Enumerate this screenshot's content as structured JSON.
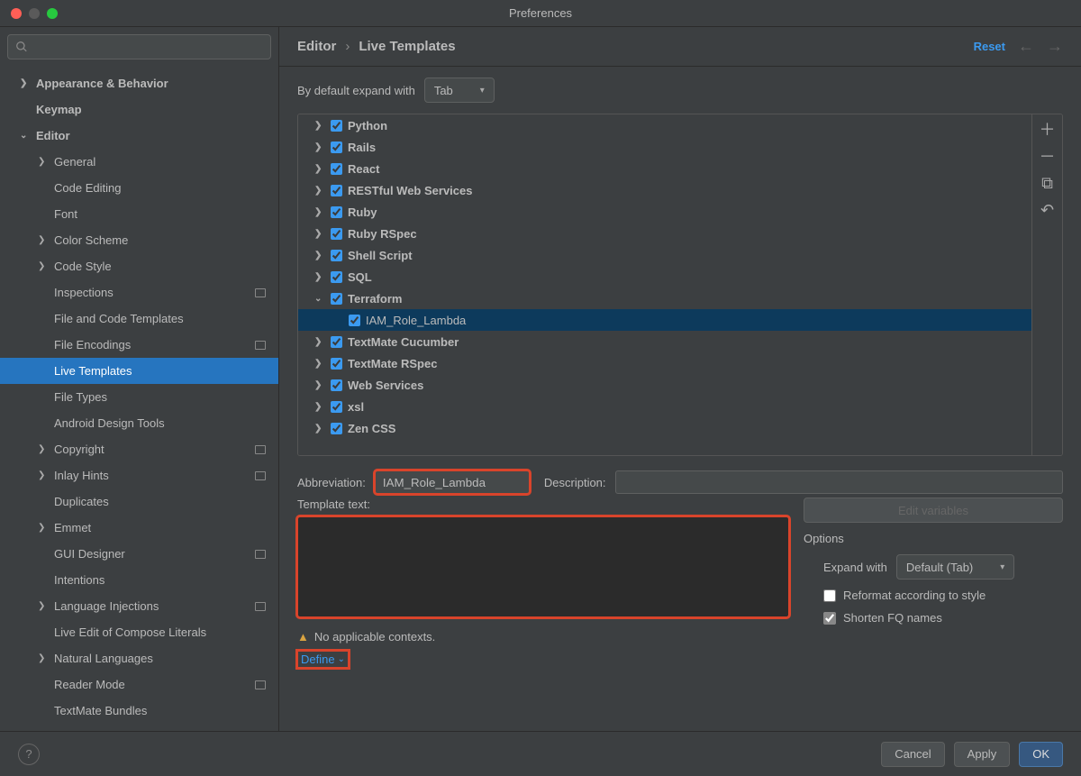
{
  "window": {
    "title": "Preferences"
  },
  "header": {
    "crumb1": "Editor",
    "crumb2": "Live Templates",
    "reset": "Reset"
  },
  "sidebar": {
    "items": [
      {
        "label": "Appearance & Behavior",
        "level": 1,
        "chev": ">"
      },
      {
        "label": "Keymap",
        "level": 1,
        "chev": ""
      },
      {
        "label": "Editor",
        "level": 1,
        "chev": "v"
      },
      {
        "label": "General",
        "level": 2,
        "chev": ">"
      },
      {
        "label": "Code Editing",
        "level": 2,
        "chev": ""
      },
      {
        "label": "Font",
        "level": 2,
        "chev": ""
      },
      {
        "label": "Color Scheme",
        "level": 2,
        "chev": ">"
      },
      {
        "label": "Code Style",
        "level": 2,
        "chev": ">"
      },
      {
        "label": "Inspections",
        "level": 2,
        "chev": "",
        "badge": true
      },
      {
        "label": "File and Code Templates",
        "level": 2,
        "chev": ""
      },
      {
        "label": "File Encodings",
        "level": 2,
        "chev": "",
        "badge": true
      },
      {
        "label": "Live Templates",
        "level": 2,
        "chev": "",
        "selected": true
      },
      {
        "label": "File Types",
        "level": 2,
        "chev": ""
      },
      {
        "label": "Android Design Tools",
        "level": 2,
        "chev": ""
      },
      {
        "label": "Copyright",
        "level": 2,
        "chev": ">",
        "badge": true
      },
      {
        "label": "Inlay Hints",
        "level": 2,
        "chev": ">",
        "badge": true
      },
      {
        "label": "Duplicates",
        "level": 2,
        "chev": ""
      },
      {
        "label": "Emmet",
        "level": 2,
        "chev": ">"
      },
      {
        "label": "GUI Designer",
        "level": 2,
        "chev": "",
        "badge": true
      },
      {
        "label": "Intentions",
        "level": 2,
        "chev": ""
      },
      {
        "label": "Language Injections",
        "level": 2,
        "chev": ">",
        "badge": true
      },
      {
        "label": "Live Edit of Compose Literals",
        "level": 2,
        "chev": ""
      },
      {
        "label": "Natural Languages",
        "level": 2,
        "chev": ">"
      },
      {
        "label": "Reader Mode",
        "level": 2,
        "chev": "",
        "badge": true
      },
      {
        "label": "TextMate Bundles",
        "level": 2,
        "chev": ""
      }
    ]
  },
  "expand": {
    "label": "By default expand with",
    "value": "Tab"
  },
  "templates": [
    {
      "label": "Python",
      "chev": ">"
    },
    {
      "label": "Rails",
      "chev": ">"
    },
    {
      "label": "React",
      "chev": ">"
    },
    {
      "label": "RESTful Web Services",
      "chev": ">"
    },
    {
      "label": "Ruby",
      "chev": ">"
    },
    {
      "label": "Ruby RSpec",
      "chev": ">"
    },
    {
      "label": "Shell Script",
      "chev": ">"
    },
    {
      "label": "SQL",
      "chev": ">"
    },
    {
      "label": "Terraform",
      "chev": "v",
      "children": [
        {
          "label": "IAM_Role_Lambda",
          "selected": true
        }
      ]
    },
    {
      "label": "TextMate Cucumber",
      "chev": ">"
    },
    {
      "label": "TextMate RSpec",
      "chev": ">"
    },
    {
      "label": "Web Services",
      "chev": ">"
    },
    {
      "label": "xsl",
      "chev": ">"
    },
    {
      "label": "Zen CSS",
      "chev": ">"
    }
  ],
  "abbr": {
    "label": "Abbreviation:",
    "value": "IAM_Role_Lambda"
  },
  "desc": {
    "label": "Description:"
  },
  "tmpl_text_label": "Template text:",
  "warn": "No applicable contexts.",
  "define": "Define",
  "opts": {
    "title": "Options",
    "edit_vars": "Edit variables",
    "expand_with_label": "Expand with",
    "expand_with_value": "Default (Tab)",
    "reformat": "Reformat according to style",
    "shorten": "Shorten FQ names"
  },
  "footer": {
    "cancel": "Cancel",
    "apply": "Apply",
    "ok": "OK"
  }
}
